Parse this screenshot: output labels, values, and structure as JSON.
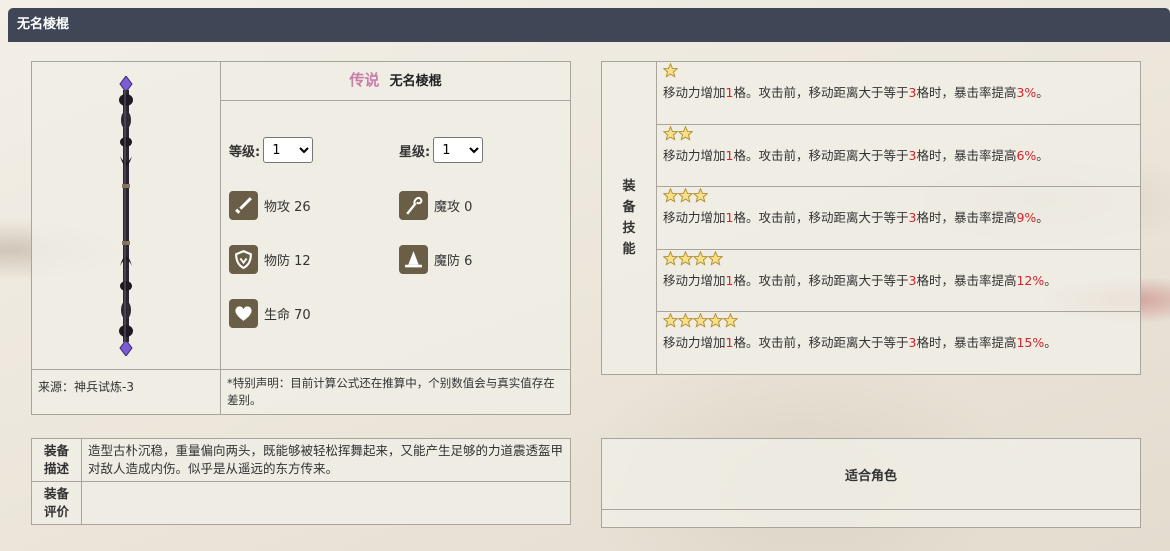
{
  "header": {
    "title": "无名棱棍"
  },
  "item": {
    "rarity": "传说",
    "name": "无名棱棍",
    "level_label": "等级:",
    "level_value": "1",
    "star_label": "星级:",
    "star_value": "1",
    "stats": [
      {
        "icon": "sword-icon",
        "text": "物攻 26"
      },
      {
        "icon": "staff-icon",
        "text": "魔攻 0"
      },
      {
        "icon": "shield-icon",
        "text": "物防 12"
      },
      {
        "icon": "wizard-hat-icon",
        "text": "魔防 6"
      },
      {
        "icon": "heart-icon",
        "text": "生命 70"
      }
    ],
    "source": "来源：神兵试炼-3",
    "note": "*特别声明：目前计算公式还在推算中，个别数值会与真实值存在差别。"
  },
  "skills": {
    "header_label": "装\n备\n技\n能",
    "tiers": [
      {
        "stars": 1,
        "pre": "移动力增加",
        "n1": "1",
        "mid": "格。攻击前，移动距离大于等于",
        "n2": "3",
        "mid2": "格时，暴击率提高",
        "pct": "3%",
        "end": "。"
      },
      {
        "stars": 2,
        "pre": "移动力增加",
        "n1": "1",
        "mid": "格。攻击前，移动距离大于等于",
        "n2": "3",
        "mid2": "格时，暴击率提高",
        "pct": "6%",
        "end": "。"
      },
      {
        "stars": 3,
        "pre": "移动力增加",
        "n1": "1",
        "mid": "格。攻击前，移动距离大于等于",
        "n2": "3",
        "mid2": "格时，暴击率提高",
        "pct": "9%",
        "end": "。"
      },
      {
        "stars": 4,
        "pre": "移动力增加",
        "n1": "1",
        "mid": "格。攻击前，移动距离大于等于",
        "n2": "3",
        "mid2": "格时，暴击率提高",
        "pct": "12%",
        "end": "。"
      },
      {
        "stars": 5,
        "pre": "移动力增加",
        "n1": "1",
        "mid": "格。攻击前，移动距离大于等于",
        "n2": "3",
        "mid2": "格时，暴击率提高",
        "pct": "15%",
        "end": "。"
      }
    ]
  },
  "description": {
    "desc_label_1": "装备",
    "desc_label_2": "描述",
    "desc_text": "造型古朴沉稳，重量偏向两头，既能够被轻松挥舞起来，又能产生足够的力道震透盔甲对敌人造成内伤。似乎是从遥远的东方传来。",
    "eval_label_1": "装备",
    "eval_label_2": "评价",
    "eval_text": ""
  },
  "roles": {
    "title": "适合角色"
  },
  "colors": {
    "header_bg": "#3f4756",
    "highlight_red": "#d2232a",
    "rarity_pink": "#c77fa8",
    "icon_bg": "#6b5e47"
  }
}
